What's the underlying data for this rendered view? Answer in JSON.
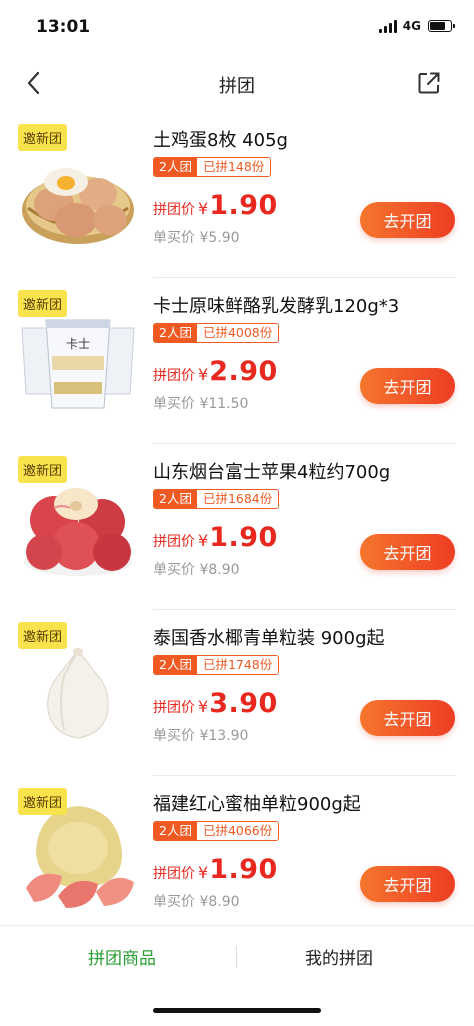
{
  "status": {
    "time": "13:01",
    "network": "4G"
  },
  "nav": {
    "title": "拼团",
    "back_icon": "chevron-left-icon",
    "share_icon": "share-icon"
  },
  "products": [
    {
      "badge": "邀新团",
      "title": "土鸡蛋8枚 405g",
      "group_size": "2人团",
      "group_count": "已拼148份",
      "price_label": "拼团价",
      "currency": "¥",
      "price": "1.90",
      "single_price": "单买价 ¥5.90",
      "button": "去开团",
      "image": "eggs"
    },
    {
      "badge": "邀新团",
      "title": "卡士原味鲜酪乳发酵乳120g*3",
      "group_size": "2人团",
      "group_count": "已拼4008份",
      "price_label": "拼团价",
      "currency": "¥",
      "price": "2.90",
      "single_price": "单买价 ¥11.50",
      "button": "去开团",
      "image": "yogurt",
      "image_text": "卡士"
    },
    {
      "badge": "邀新团",
      "title": "山东烟台富士苹果4粒约700g",
      "group_size": "2人团",
      "group_count": "已拼1684份",
      "price_label": "拼团价",
      "currency": "¥",
      "price": "1.90",
      "single_price": "单买价 ¥8.90",
      "button": "去开团",
      "image": "apples"
    },
    {
      "badge": "邀新团",
      "title": "泰国香水椰青单粒装 900g起",
      "group_size": "2人团",
      "group_count": "已拼1748份",
      "price_label": "拼团价",
      "currency": "¥",
      "price": "3.90",
      "single_price": "单买价 ¥13.90",
      "button": "去开团",
      "image": "coconut"
    },
    {
      "badge": "邀新团",
      "title": "福建红心蜜柚单粒900g起",
      "group_size": "2人团",
      "group_count": "已拼4066份",
      "price_label": "拼团价",
      "currency": "¥",
      "price": "1.90",
      "single_price": "单买价 ¥8.90",
      "button": "去开团",
      "image": "pomelo"
    }
  ],
  "tabs": {
    "active": "拼团商品",
    "inactive": "我的拼团"
  },
  "colors": {
    "accent_red": "#e8281e",
    "button_orange": "#f05a22",
    "active_tab_green": "#2b9e33",
    "badge_yellow": "#f9e34d"
  }
}
